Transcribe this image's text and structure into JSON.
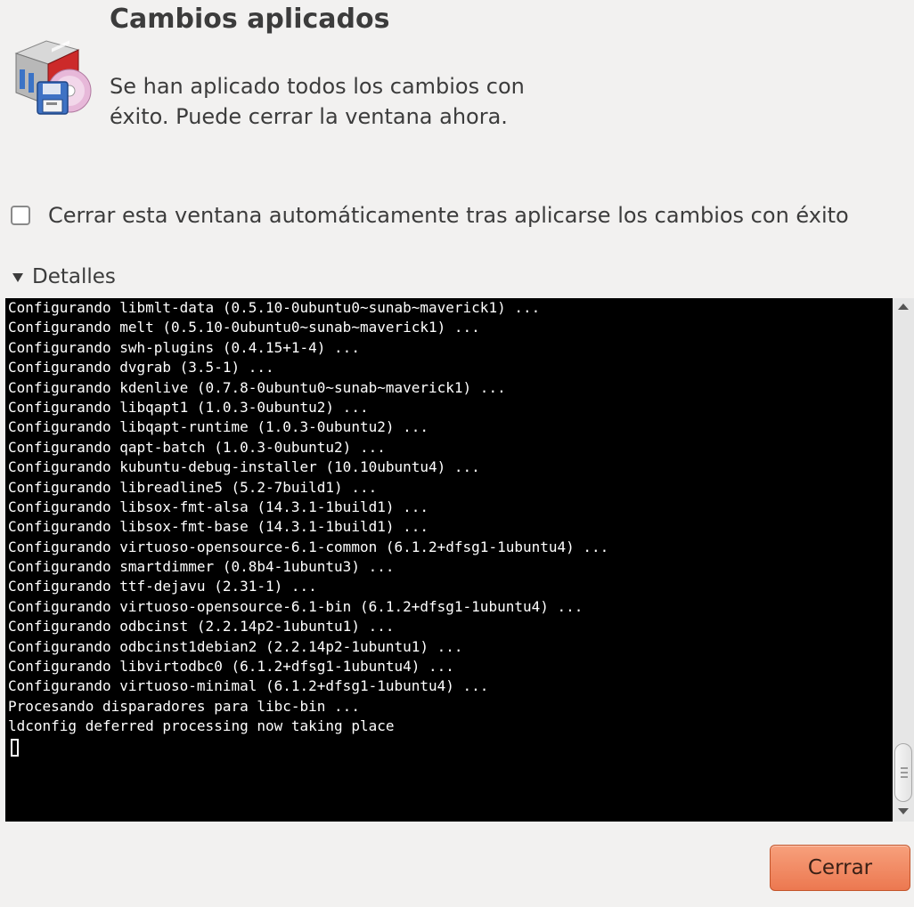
{
  "dialog": {
    "title": "Cambios aplicados",
    "message": "Se han aplicado todos los cambios con éxito. Puede cerrar la ventana ahora.",
    "icon": "package-installer-icon"
  },
  "auto_close": {
    "label": "Cerrar esta ventana automáticamente tras aplicarse los cambios con éxito",
    "checked": false
  },
  "details": {
    "label": "Detalles",
    "expanded": true
  },
  "terminal": {
    "background": "#000000",
    "foreground": "#ffffff",
    "lines": [
      "Configurando libmlt-data (0.5.10-0ubuntu0~sunab~maverick1) ...",
      "Configurando melt (0.5.10-0ubuntu0~sunab~maverick1) ...",
      "Configurando swh-plugins (0.4.15+1-4) ...",
      "Configurando dvgrab (3.5-1) ...",
      "Configurando kdenlive (0.7.8-0ubuntu0~sunab~maverick1) ...",
      "Configurando libqapt1 (1.0.3-0ubuntu2) ...",
      "Configurando libqapt-runtime (1.0.3-0ubuntu2) ...",
      "Configurando qapt-batch (1.0.3-0ubuntu2) ...",
      "Configurando kubuntu-debug-installer (10.10ubuntu4) ...",
      "Configurando libreadline5 (5.2-7build1) ...",
      "Configurando libsox-fmt-alsa (14.3.1-1build1) ...",
      "Configurando libsox-fmt-base (14.3.1-1build1) ...",
      "Configurando virtuoso-opensource-6.1-common (6.1.2+dfsg1-1ubuntu4) ...",
      "Configurando smartdimmer (0.8b4-1ubuntu3) ...",
      "Configurando ttf-dejavu (2.31-1) ...",
      "Configurando virtuoso-opensource-6.1-bin (6.1.2+dfsg1-1ubuntu4) ...",
      "Configurando odbcinst (2.2.14p2-1ubuntu1) ...",
      "Configurando odbcinst1debian2 (2.2.14p2-1ubuntu1) ...",
      "Configurando libvirtodbc0 (6.1.2+dfsg1-1ubuntu4) ...",
      "Configurando virtuoso-minimal (6.1.2+dfsg1-1ubuntu4) ...",
      "Procesando disparadores para libc-bin ...",
      "ldconfig deferred processing now taking place"
    ]
  },
  "buttons": {
    "close_label": "Cerrar"
  },
  "colors": {
    "window_bg": "#f2f1f0",
    "text": "#3c3c3c",
    "accent_button": "#ec7850"
  }
}
